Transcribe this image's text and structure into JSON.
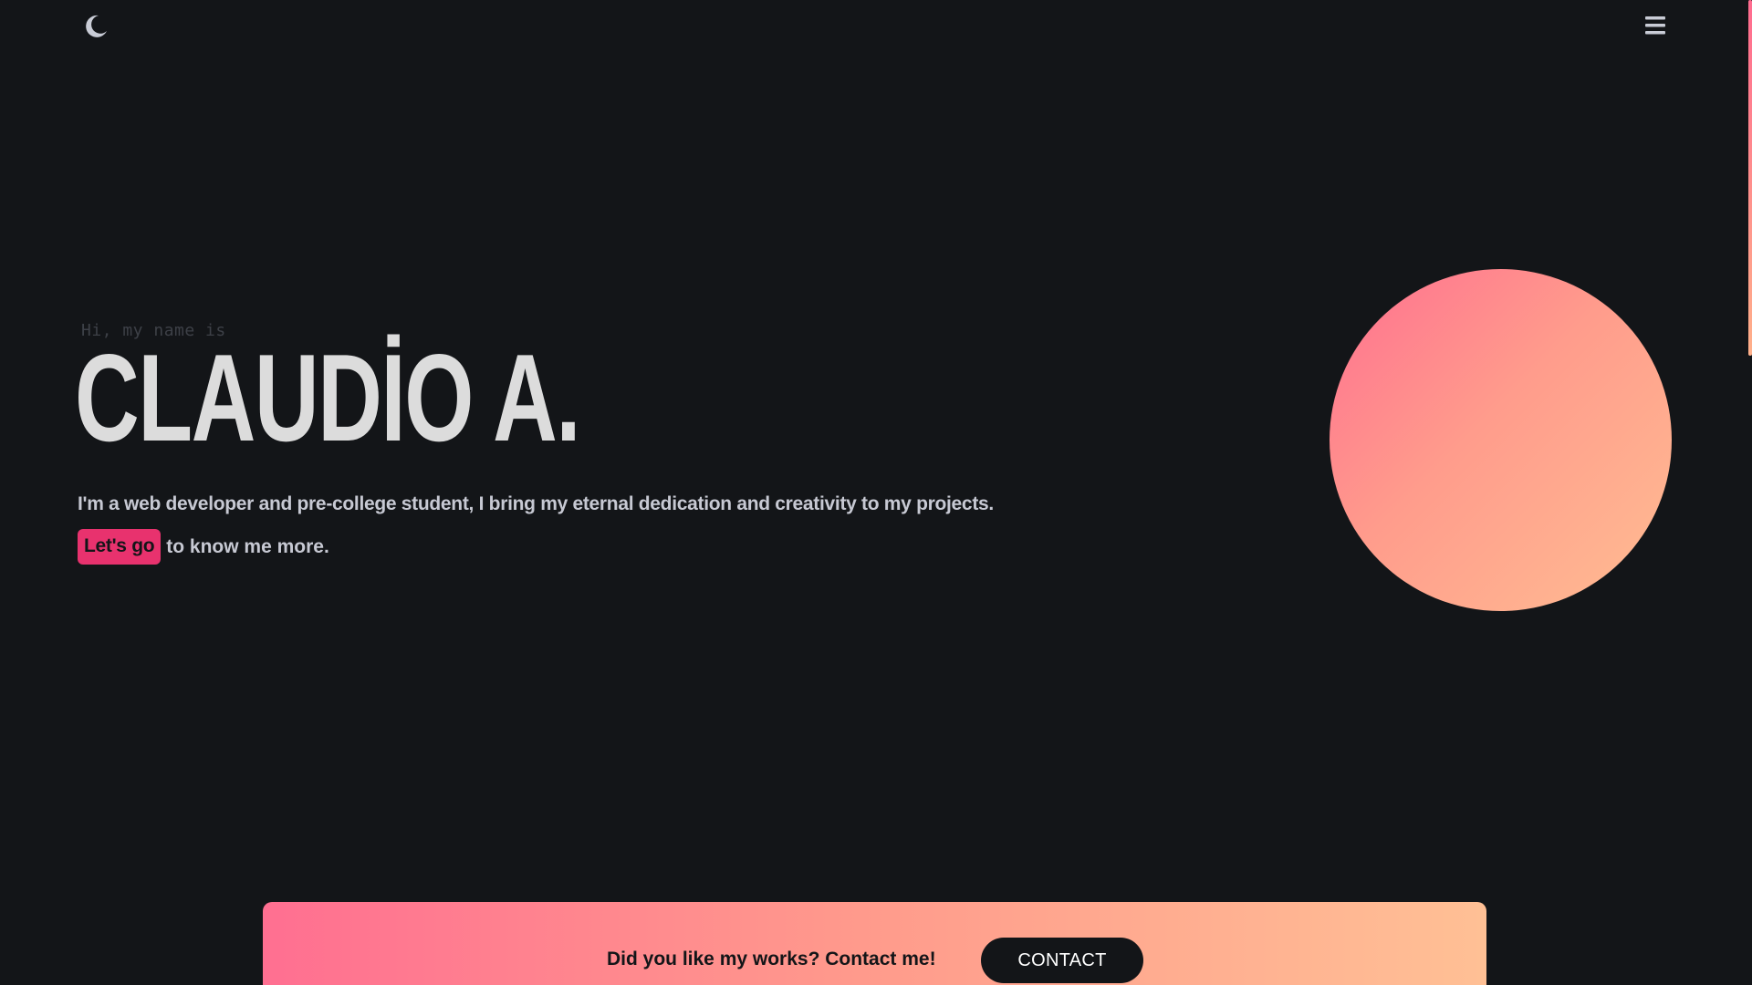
{
  "header": {
    "theme_toggle_icon": "moon-icon",
    "menu_icon": "hamburger-menu-icon"
  },
  "hero": {
    "greeting": "Hi, my name is",
    "name": "CLAUDİO A.",
    "bio": "I'm a web developer and pre-college student, I bring my eternal dedication and creativity to my projects.",
    "cta_button": "Let's go",
    "cta_suffix": "to know me more."
  },
  "banner": {
    "text": "Did you like my works? Contact me!",
    "button_label": "CONTACT"
  },
  "colors": {
    "background": "#131518",
    "accent_pink": "#e8326e",
    "gradient_start": "#ff6f91",
    "gradient_end": "#ffc095",
    "text_light": "#c7c9d3",
    "heading": "#dcdcdc"
  }
}
